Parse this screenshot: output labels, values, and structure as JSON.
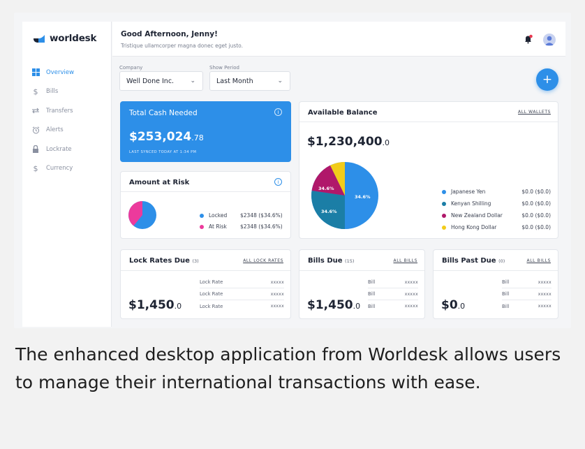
{
  "app": {
    "logo_text_a": "worl",
    "logo_text_b": "desk",
    "brand_color": "#2d8fe8"
  },
  "sidebar": {
    "items": [
      {
        "label": "Overview",
        "icon": "grid-icon"
      },
      {
        "label": "Bills",
        "icon": "dollar-icon"
      },
      {
        "label": "Transfers",
        "icon": "transfer-arrows-icon"
      },
      {
        "label": "Alerts",
        "icon": "alarm-clock-icon"
      },
      {
        "label": "Lockrate",
        "icon": "lock-icon"
      },
      {
        "label": "Currency",
        "icon": "dollar-icon"
      }
    ]
  },
  "header": {
    "greeting": "Good Afternoon, Jenny!",
    "subtitle": "Tristique ullamcorper magna donec eget justo."
  },
  "filters": {
    "company_label": "Company",
    "company_value": "Well Done Inc.",
    "period_label": "Show Period",
    "period_value": "Last Month",
    "add_label": "+"
  },
  "total_cash": {
    "title": "Total Cash Needed",
    "amount_main": "$253,024",
    "amount_cents": ".78",
    "sync_text": "LAST SYNCED TODAY AT 1:34 PM"
  },
  "amount_at_risk": {
    "title": "Amount at Risk",
    "legend": [
      {
        "label": "Locked",
        "value": "$2348 ($34.6%)",
        "color": "#2d8fe8"
      },
      {
        "label": "At Risk",
        "value": "$2348 ($34.6%)",
        "color": "#ec3a9c"
      }
    ]
  },
  "available_balance": {
    "title": "Available Balance",
    "link": "ALL WALLETS",
    "amount_main": "$1,230,400",
    "amount_cents": ".0",
    "pie_labels": [
      "34.6%",
      "34.6%",
      "34.6%"
    ],
    "legend": [
      {
        "label": "Japanese Yen",
        "value": "$0.0  ($0.0)",
        "color": "#2d8fe8"
      },
      {
        "label": "Kenyan Shilling",
        "value": "$0.0  ($0.0)",
        "color": "#1b7ea6"
      },
      {
        "label": "New Zealand Dollar",
        "value": "$0.0  ($0.0)",
        "color": "#b0186a"
      },
      {
        "label": "Hong Kong Dollar",
        "value": "$0.0  ($0.0)",
        "color": "#f2cc1a"
      }
    ]
  },
  "lock_rates": {
    "title": "Lock Rates Due",
    "count": "(3)",
    "link": "ALL LOCK RATES",
    "amount_main": "$1,450",
    "amount_cents": ".0",
    "rows": [
      {
        "label": "Lock Rate",
        "value": "xxxxx"
      },
      {
        "label": "Lock Rate",
        "value": "xxxxx"
      },
      {
        "label": "Lock Rate",
        "value": "xxxxx"
      }
    ]
  },
  "bills_due": {
    "title": "Bills Due",
    "count": "(15)",
    "link": "ALL BILLS",
    "amount_main": "$1,450",
    "amount_cents": ".0",
    "rows": [
      {
        "label": "Bill",
        "value": "xxxxx"
      },
      {
        "label": "Bill",
        "value": "xxxxx"
      },
      {
        "label": "Bill",
        "value": "xxxxx"
      }
    ]
  },
  "bills_past_due": {
    "title": "Bills Past Due",
    "count": "(0)",
    "link": "ALL BILLS",
    "amount_main": "$0",
    "amount_cents": ".0",
    "rows": [
      {
        "label": "Bill",
        "value": "xxxxx"
      },
      {
        "label": "Bill",
        "value": "xxxxx"
      },
      {
        "label": "Bill",
        "value": "xxxxx"
      }
    ]
  },
  "caption": "The enhanced desktop application from Worldesk allows users to manage their international transactions with ease."
}
